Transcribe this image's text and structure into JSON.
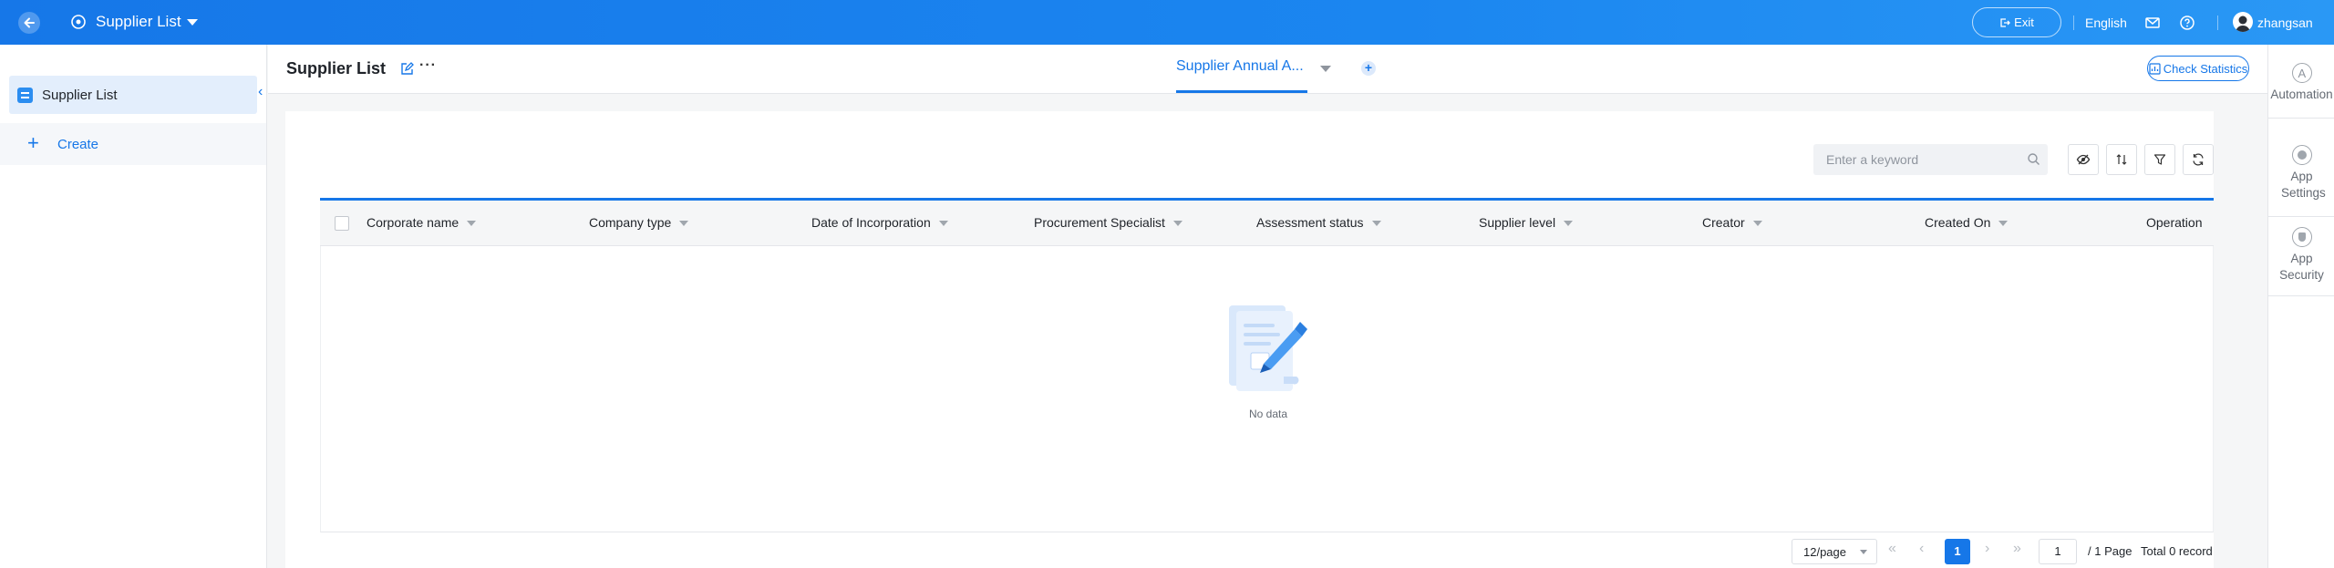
{
  "topbar": {
    "app_title": "Supplier List",
    "exit_label": "Exit",
    "language": "English",
    "username": "zhangsan"
  },
  "sidebar": {
    "items": [
      {
        "label": "Supplier List"
      }
    ],
    "create_label": "Create"
  },
  "header": {
    "title": "Supplier List",
    "view_tab": "Supplier Annual A...",
    "check_statistics_label": "Check Statistics"
  },
  "right_rail": {
    "items": [
      {
        "label": "Automation"
      },
      {
        "label": "App Settings"
      },
      {
        "label": "App Security"
      }
    ]
  },
  "toolbar": {
    "search_placeholder": "Enter a keyword"
  },
  "table": {
    "columns": [
      "Corporate name",
      "Company type",
      "Date of Incorporation",
      "Procurement Specialist",
      "Assessment status",
      "Supplier level",
      "Creator",
      "Created On",
      "Operation"
    ],
    "rows": [],
    "empty_text": "No data"
  },
  "pagination": {
    "page_size": "12/page",
    "current_page": "1",
    "page_input": "1",
    "total_pages": "/ 1 Page",
    "total_records": "Total 0 record"
  },
  "colors": {
    "primary": "#1677e8",
    "topbar": "#1b86f0"
  }
}
